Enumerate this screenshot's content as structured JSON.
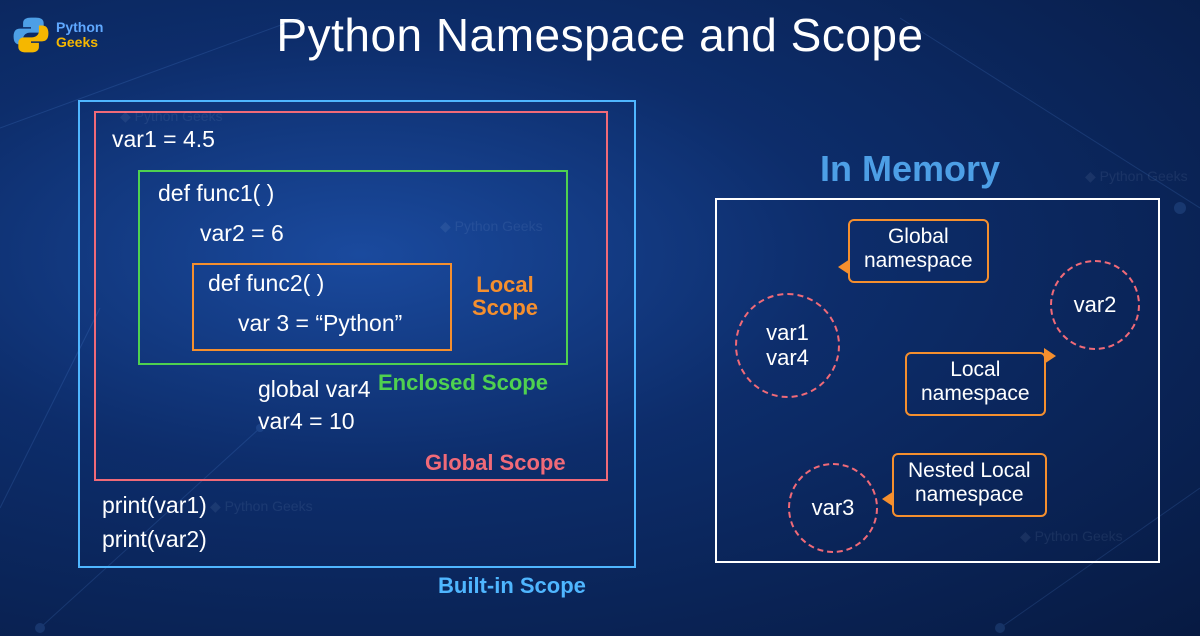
{
  "brand": {
    "line1": "Python",
    "line2": "Geeks"
  },
  "title": "Python Namespace and Scope",
  "code": {
    "var1": "var1 = 4.5",
    "def1": "def func1( )",
    "var2": "var2 = 6",
    "def2": "def func2( )",
    "var3": "var 3 = “Python”",
    "global_var4": "global var4",
    "var4": "var4 = 10",
    "print1": "print(var1)",
    "print2": "print(var2)"
  },
  "labels": {
    "local": "Local\nScope",
    "enclosed": "Enclosed Scope",
    "global": "Global Scope",
    "builtin": "Built-in Scope"
  },
  "memory": {
    "title": "In Memory",
    "bubble_a_l1": "var1",
    "bubble_a_l2": "var4",
    "bubble_b": "var2",
    "bubble_c": "var3",
    "global_ns": "Global\nnamespace",
    "local_ns": "Local\nnamespace",
    "nested_ns": "Nested Local\nnamespace"
  }
}
